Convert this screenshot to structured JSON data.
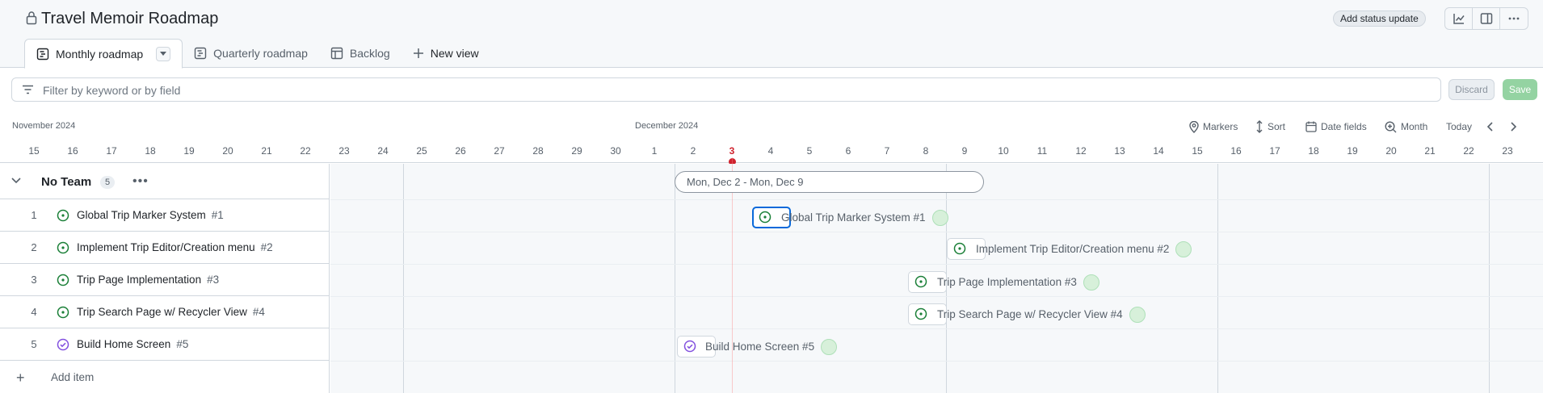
{
  "project": {
    "title": "Travel Memoir Roadmap",
    "status_button": "Add status update"
  },
  "tabs": [
    {
      "label": "Monthly roadmap",
      "icon": "roadmap-icon",
      "active": true
    },
    {
      "label": "Quarterly roadmap",
      "icon": "roadmap-icon",
      "active": false
    },
    {
      "label": "Backlog",
      "icon": "table-icon",
      "active": false
    },
    {
      "label": "New view",
      "icon": "plus-icon",
      "active": false
    }
  ],
  "filter": {
    "placeholder": "Filter by keyword or by field",
    "discard": "Discard",
    "save": "Save"
  },
  "timeline": {
    "months": [
      "November 2024",
      "December 2024"
    ],
    "controls": {
      "markers": "Markers",
      "sort": "Sort",
      "date_fields": "Date fields",
      "zoom": "Month",
      "today": "Today"
    },
    "days": [
      "15",
      "16",
      "17",
      "18",
      "19",
      "20",
      "21",
      "22",
      "23",
      "24",
      "25",
      "26",
      "27",
      "28",
      "29",
      "30",
      "1",
      "2",
      "3",
      "4",
      "5",
      "6",
      "7",
      "8",
      "9",
      "10",
      "11",
      "12",
      "13",
      "14",
      "15",
      "16",
      "17",
      "18",
      "19",
      "20",
      "21",
      "22",
      "23",
      "2"
    ],
    "today_day": "3",
    "range_label": "Mon, Dec 2 - Mon, Dec 9"
  },
  "group": {
    "name": "No Team",
    "count": "5",
    "more": "•••"
  },
  "items": [
    {
      "num": "1",
      "title": "Global Trip Marker System",
      "ref": "#1",
      "status": "open",
      "bar_label": "Global Trip Marker System #1"
    },
    {
      "num": "2",
      "title": "Implement Trip Editor/Creation menu",
      "ref": "#2",
      "status": "open",
      "bar_label": "Implement Trip Editor/Creation menu #2"
    },
    {
      "num": "3",
      "title": "Trip Page Implementation",
      "ref": "#3",
      "status": "open",
      "bar_label": "Trip Page Implementation #3"
    },
    {
      "num": "4",
      "title": "Trip Search Page w/ Recycler View",
      "ref": "#4",
      "status": "open",
      "bar_label": "Trip Search Page w/ Recycler View #4"
    },
    {
      "num": "5",
      "title": "Build Home Screen",
      "ref": "#5",
      "status": "closed",
      "bar_label": "Build Home Screen #5"
    }
  ],
  "add_item": "Add item",
  "colors": {
    "open": "#1a7f37",
    "closed": "#8250df",
    "today": "#cf222e",
    "selected": "#0969da",
    "save": "#94d3a2"
  }
}
